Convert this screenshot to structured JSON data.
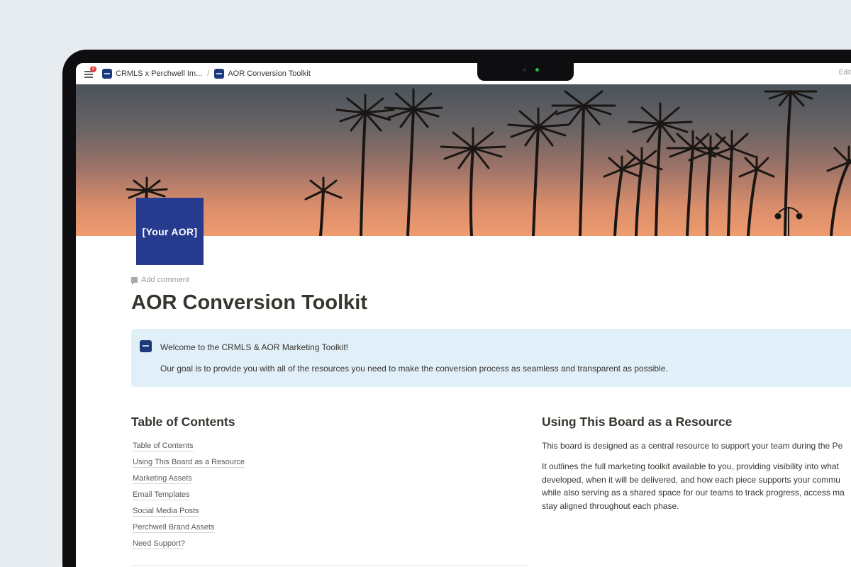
{
  "topbar": {
    "notification_count": "2",
    "breadcrumbs": [
      {
        "label": "CRMLS x Perchwell Im..."
      },
      {
        "label": "AOR Conversion Toolkit"
      }
    ],
    "status_text": "Edited"
  },
  "cover": {
    "scene": "palm trees silhouetted against sunset sky"
  },
  "page_icon": {
    "text": "[Your AOR]",
    "color": "#263a8e"
  },
  "add_comment_label": "Add comment",
  "page_title": "AOR Conversion Toolkit",
  "callout": {
    "heading": "Welcome to the CRMLS & AOR Marketing Toolkit!",
    "body": "Our goal is to provide you with all of the resources you need to make the conversion process as seamless and transparent as possible.",
    "background": "#e1eff9"
  },
  "toc": {
    "heading": "Table of Contents",
    "items": [
      "Table of Contents",
      "Using This Board as a Resource",
      "Marketing Assets",
      "Email Templates",
      "Social Media Posts",
      "Perchwell Brand Assets",
      "Need Support?"
    ]
  },
  "resource": {
    "heading": "Using This Board as a Resource",
    "para1": "This board is designed as a central resource to support your team during the Pe",
    "para2_lines": [
      "It outlines the full marketing toolkit available to you, providing visibility into what",
      "developed, when it will be delivered, and how each piece supports your commu",
      "while also serving as a shared space for our teams to track progress, access ma",
      "stay aligned throughout each phase."
    ]
  }
}
